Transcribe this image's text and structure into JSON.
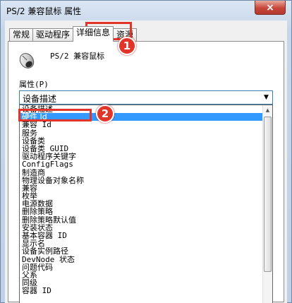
{
  "window": {
    "title": "PS/2 兼容鼠标 属性",
    "close_icon": "×"
  },
  "tabs": [
    {
      "label": "常规"
    },
    {
      "label": "驱动程序"
    },
    {
      "label": "详细信息"
    },
    {
      "label": "资源"
    }
  ],
  "device": {
    "name": "PS/2 兼容鼠标",
    "icon": "mouse-icon"
  },
  "property": {
    "label": "属性(P)",
    "selected": "设备描述",
    "options": [
      {
        "label": "设备描述"
      },
      {
        "label": "硬件 Id"
      },
      {
        "label": "兼容 Id"
      },
      {
        "label": "服务"
      },
      {
        "label": "设备类"
      },
      {
        "label": "设备类 GUID"
      },
      {
        "label": "驱动程序关键字"
      },
      {
        "label": "ConfigFlags"
      },
      {
        "label": "制造商"
      },
      {
        "label": "物理设备对象名称"
      },
      {
        "label": "兼容"
      },
      {
        "label": "枚举"
      },
      {
        "label": "电源数据"
      },
      {
        "label": "删除策略"
      },
      {
        "label": "删除策略默认值"
      },
      {
        "label": "安装状态"
      },
      {
        "label": "基本容器 ID"
      },
      {
        "label": "显示名"
      },
      {
        "label": "设备实例路径"
      },
      {
        "label": "DevNode 状态"
      },
      {
        "label": "问题代码"
      },
      {
        "label": "父系"
      },
      {
        "label": "同级"
      },
      {
        "label": "容器 ID"
      }
    ],
    "highlighted_index": 1
  },
  "annotations": {
    "step1": "1",
    "step2": "2",
    "color": "#e1352a"
  }
}
